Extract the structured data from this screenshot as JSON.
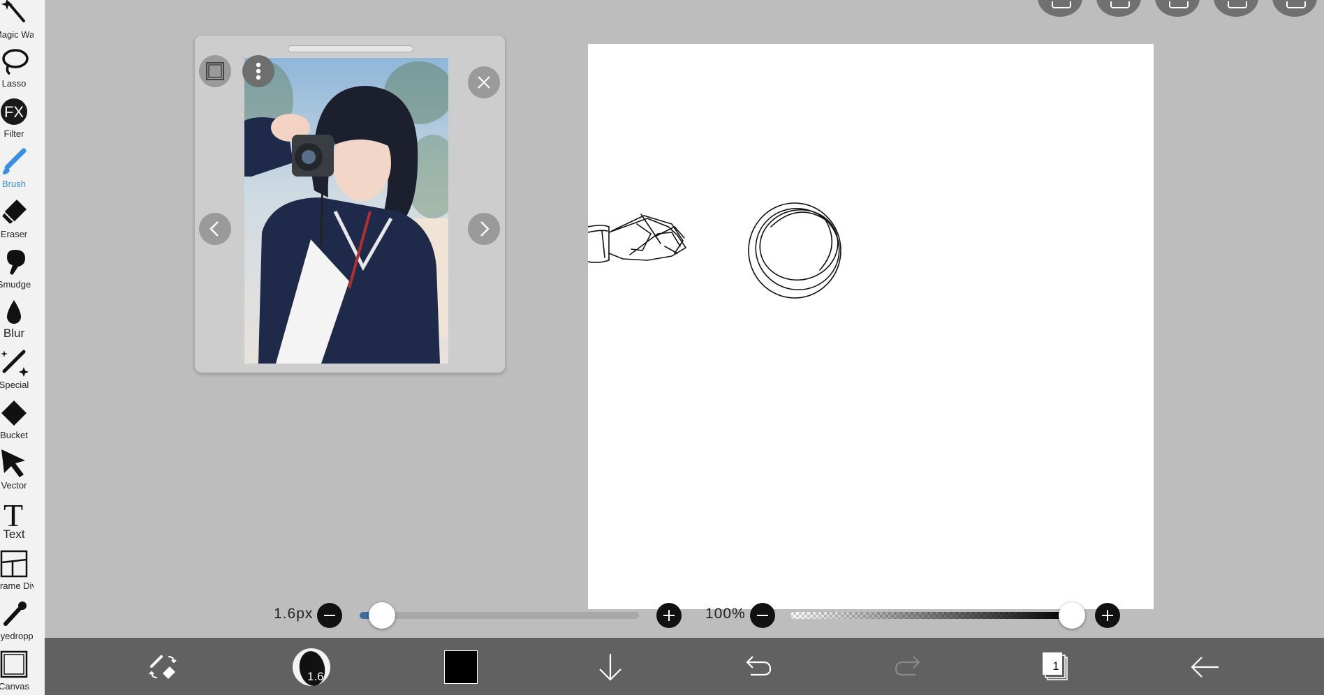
{
  "left_toolbar": {
    "tools": [
      {
        "label": "Magic Wand",
        "icon": "magic-wand-icon"
      },
      {
        "label": "Lasso",
        "icon": "lasso-icon"
      },
      {
        "label": "Filter",
        "icon": "fx-icon",
        "icon_text": "FX"
      },
      {
        "label": "Brush",
        "icon": "brush-icon",
        "active": true
      },
      {
        "label": "Eraser",
        "icon": "eraser-icon"
      },
      {
        "label": "Smudge",
        "icon": "smudge-icon"
      },
      {
        "label": "Blur",
        "icon": "blur-drop-icon"
      },
      {
        "label": "Special",
        "icon": "special-pen-icon"
      },
      {
        "label": "Bucket",
        "icon": "bucket-icon"
      },
      {
        "label": "Vector",
        "icon": "vector-cursor-icon"
      },
      {
        "label": "Text",
        "icon": "text-icon",
        "icon_text": "T"
      },
      {
        "label": "Frame Divider",
        "icon": "frame-divider-icon"
      },
      {
        "label": "Eyedropper",
        "icon": "eyedropper-icon"
      },
      {
        "label": "Canvas",
        "icon": "canvas-icon"
      }
    ],
    "active_color": "#3a8fe0"
  },
  "sliders": {
    "brush_size": {
      "label": "1.6px",
      "value_fraction": 0.02
    },
    "opacity": {
      "label": "100%",
      "value_fraction": 1.0
    }
  },
  "bottom_toolbar": {
    "brush_size_preview": "1.6",
    "current_color": "#000000",
    "layer_count": "1"
  },
  "colors": {
    "accent": "#3a8fe0",
    "toolbar_bg": "#f2f2f2",
    "bottom_bar_bg": "#616161",
    "workspace_bg": "#bdbdbd"
  }
}
